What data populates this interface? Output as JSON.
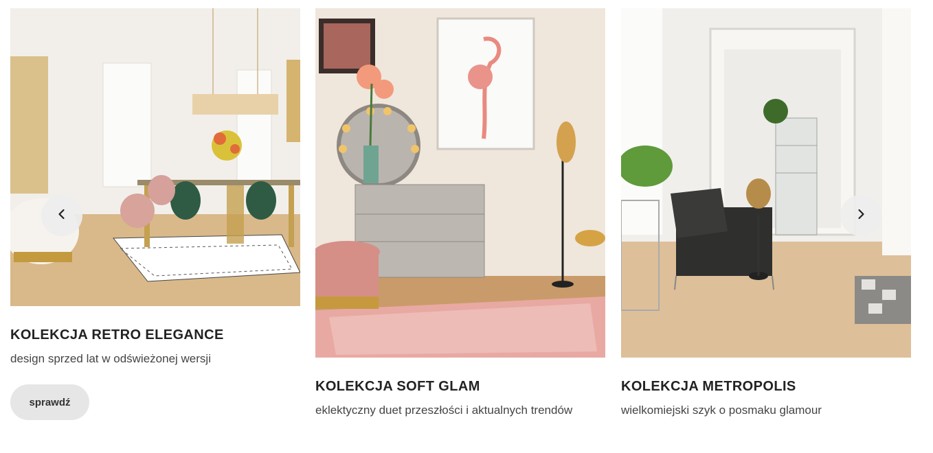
{
  "collections": [
    {
      "title": "KOLEKCJA RETRO ELEGANCE",
      "subtitle": "design sprzed lat w odświeżonej wersji",
      "button_label": "sprawdź",
      "image": "retro-elegance-dining-room"
    },
    {
      "title": "KOLEKCJA SOFT GLAM",
      "subtitle": "eklektyczny duet przeszłości i aktualnych trendów",
      "image": "soft-glam-dresser-flamingo"
    },
    {
      "title": "KOLEKCJA METROPOLIS",
      "subtitle": "wielkomiejski szyk o posmaku glamour",
      "image": "metropolis-armchair-room"
    }
  ],
  "carousel": {
    "prev_icon": "chevron-left-icon",
    "next_icon": "chevron-right-icon"
  }
}
